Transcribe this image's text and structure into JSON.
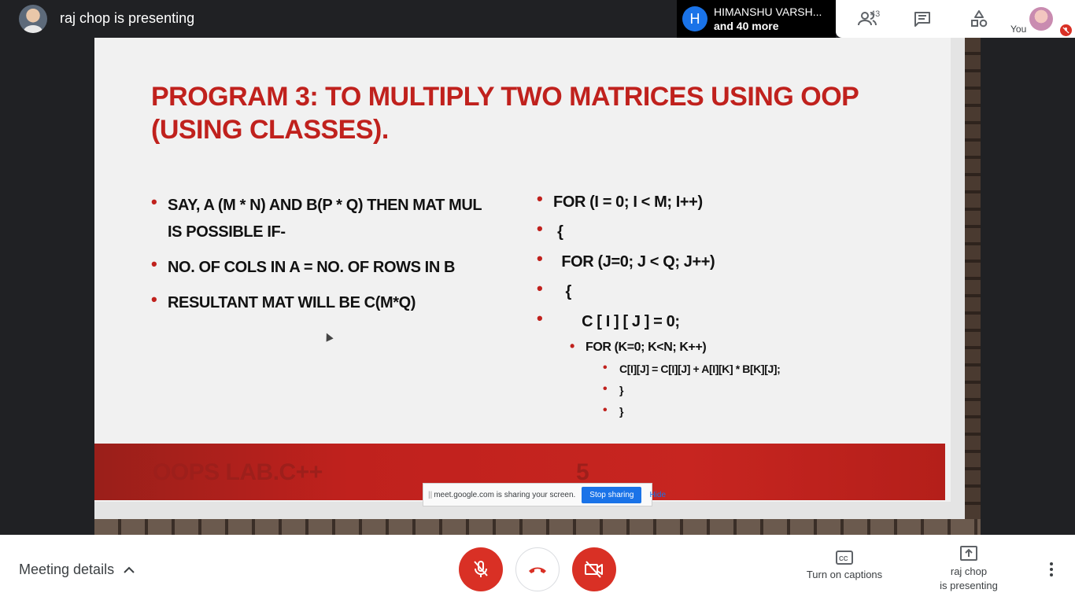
{
  "topbar": {
    "presenter_title": "raj chop is presenting",
    "participant_chip": {
      "avatar_letter": "H",
      "name": "HIMANSHU VARSH...",
      "more": "and 40 more"
    },
    "participants_count": "43",
    "self_label": "You"
  },
  "slide": {
    "title": "PROGRAM 3: TO MULTIPLY TWO MATRICES USING OOP (USING CLASSES).",
    "left_bullets": [
      "SAY, A (M * N) AND B(P * Q) THEN MAT MUL IS POSSIBLE IF-",
      "NO. OF COLS IN A = NO. OF ROWS IN B",
      "RESULTANT MAT WILL BE C(M*Q)"
    ],
    "right_bullets": [
      "FOR (I = 0; I < M; I++)",
      " {",
      "  FOR (J=0; J < Q; J++)",
      "   {",
      "       C [ I ] [ J ] = 0;",
      "FOR (K=0; K<N; K++)",
      "C[I][J] = C[I][J] + A[I][K] * B[K][J];",
      "}",
      "}"
    ],
    "footer_left": "OOPS LAB.C++",
    "page_number": "5"
  },
  "share_bar": {
    "grip": "||",
    "message": "meet.google.com is sharing your screen.",
    "stop_label": "Stop sharing",
    "hide_label": "Hide"
  },
  "bottombar": {
    "meeting_details": "Meeting details",
    "captions_label": "Turn on captions",
    "presenting_label_1": "raj chop",
    "presenting_label_2": "is presenting"
  },
  "colors": {
    "end_call_red": "#d93025",
    "slide_accent": "#c0211d",
    "link_blue": "#1a73e8"
  }
}
